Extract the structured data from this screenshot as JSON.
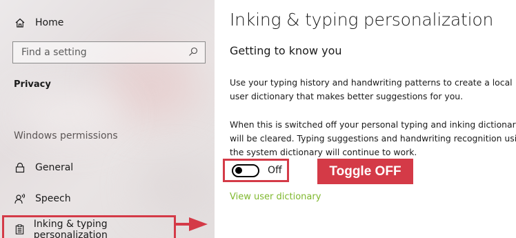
{
  "sidebar": {
    "home_label": "Home",
    "search_placeholder": "Find a setting",
    "section_title": "Privacy",
    "group_title": "Windows permissions",
    "items": [
      {
        "label": "General",
        "icon": "lock-icon"
      },
      {
        "label": "Speech",
        "icon": "speech-icon"
      },
      {
        "label": "Inking & typing personalization",
        "icon": "clipboard-icon"
      }
    ]
  },
  "main": {
    "title": "Inking & typing personalization",
    "subheading": "Getting to know you",
    "para1": "Use your typing history and handwriting patterns to create a local user dictionary that makes better suggestions for you.",
    "para2": "When this is switched off your personal typing and inking dictionary will be cleared. Typing suggestions and handwriting recognition using the system dictionary will continue to work.",
    "toggle_state": "Off",
    "toggle_annotation": "Toggle OFF",
    "link": "View user dictionary"
  },
  "colors": {
    "annotation_red": "#d43a47",
    "link_green": "#7fb82e"
  }
}
